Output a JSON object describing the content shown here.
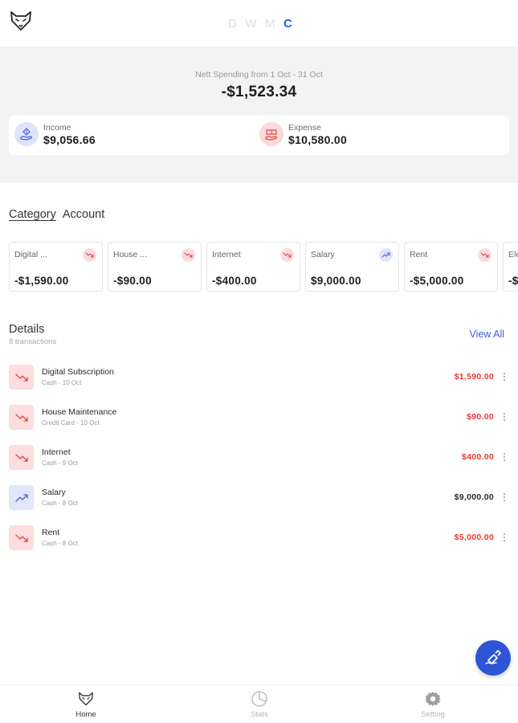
{
  "header": {
    "logo_icon": "fox-logo-icon",
    "period_tabs": [
      {
        "label": "D",
        "active": false
      },
      {
        "label": "W",
        "active": false
      },
      {
        "label": "M",
        "active": false
      },
      {
        "label": "C",
        "active": true
      }
    ]
  },
  "summary": {
    "nett_label": "Nett Spending from 1 Oct - 31 Oct",
    "nett_value": "-$1,523.34",
    "income": {
      "label": "Income",
      "value": "$9,056.66",
      "icon": "income-hand-icon"
    },
    "expense": {
      "label": "Expense",
      "value": "$10,580.00",
      "icon": "expense-hand-icon"
    }
  },
  "view_tabs": [
    {
      "label": "Category",
      "active": true
    },
    {
      "label": "Account",
      "active": false
    }
  ],
  "categories": [
    {
      "name": "Digital ...",
      "value": "-$1,590.00",
      "trend": "down"
    },
    {
      "name": "House ...",
      "value": "-$90.00",
      "trend": "down"
    },
    {
      "name": "Internet",
      "value": "-$400.00",
      "trend": "down"
    },
    {
      "name": "Salary",
      "value": "$9,000.00",
      "trend": "up"
    },
    {
      "name": "Rent",
      "value": "-$5,000.00",
      "trend": "down"
    },
    {
      "name": "Ele",
      "value": "-$",
      "trend": "down"
    }
  ],
  "details": {
    "title": "Details",
    "count": "8 transactions",
    "view_all": "View All",
    "transactions": [
      {
        "title": "Digital Subscription",
        "sub": "Cash - 10 Oct",
        "amount": "$1,590.00",
        "trend": "down"
      },
      {
        "title": "House Maintenance",
        "sub": "Credit Card - 10 Oct",
        "amount": "$90.00",
        "trend": "down"
      },
      {
        "title": "Internet",
        "sub": "Cash - 9 Oct",
        "amount": "$400.00",
        "trend": "down"
      },
      {
        "title": "Salary",
        "sub": "Cash - 8 Oct",
        "amount": "$9,000.00",
        "trend": "up"
      },
      {
        "title": "Rent",
        "sub": "Cash - 8 Oct",
        "amount": "$5,000.00",
        "trend": "down"
      }
    ]
  },
  "fab": {
    "icon": "add-transaction-icon"
  },
  "bottom_nav": [
    {
      "label": "Home",
      "icon": "fox-home-icon",
      "active": true
    },
    {
      "label": "Stats",
      "icon": "pie-chart-icon",
      "active": false
    },
    {
      "label": "Setting",
      "icon": "gear-icon",
      "active": false
    }
  ],
  "colors": {
    "accent": "#2e55d6",
    "negative": "#e53935",
    "income_bg": "#dfe3fb",
    "expense_bg": "#fbdada"
  }
}
